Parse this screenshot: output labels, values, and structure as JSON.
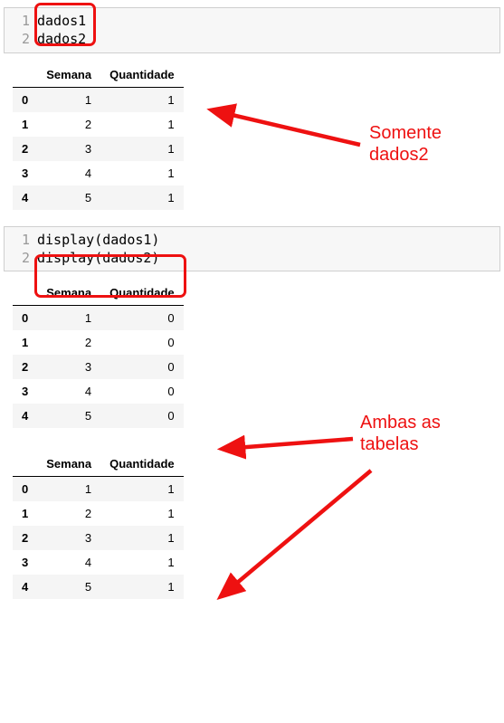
{
  "cell1": {
    "lines": [
      {
        "num": "1",
        "code": "dados1"
      },
      {
        "num": "2",
        "code": "dados2"
      }
    ]
  },
  "cell2": {
    "lines": [
      {
        "num": "1",
        "code": "display(dados1)"
      },
      {
        "num": "2",
        "code": "display(dados2)"
      }
    ]
  },
  "columns": {
    "c1": "Semana",
    "c2": "Quantidade"
  },
  "table_top": {
    "rows": [
      {
        "idx": "0",
        "semana": "1",
        "qty": "1"
      },
      {
        "idx": "1",
        "semana": "2",
        "qty": "1"
      },
      {
        "idx": "2",
        "semana": "3",
        "qty": "1"
      },
      {
        "idx": "3",
        "semana": "4",
        "qty": "1"
      },
      {
        "idx": "4",
        "semana": "5",
        "qty": "1"
      }
    ]
  },
  "table_mid": {
    "rows": [
      {
        "idx": "0",
        "semana": "1",
        "qty": "0"
      },
      {
        "idx": "1",
        "semana": "2",
        "qty": "0"
      },
      {
        "idx": "2",
        "semana": "3",
        "qty": "0"
      },
      {
        "idx": "3",
        "semana": "4",
        "qty": "0"
      },
      {
        "idx": "4",
        "semana": "5",
        "qty": "0"
      }
    ]
  },
  "table_bot": {
    "rows": [
      {
        "idx": "0",
        "semana": "1",
        "qty": "1"
      },
      {
        "idx": "1",
        "semana": "2",
        "qty": "1"
      },
      {
        "idx": "2",
        "semana": "3",
        "qty": "1"
      },
      {
        "idx": "3",
        "semana": "4",
        "qty": "1"
      },
      {
        "idx": "4",
        "semana": "5",
        "qty": "1"
      }
    ]
  },
  "annotations": {
    "only_dados2": "Somente\ndados2",
    "both_tables": "Ambas as\ntabelas"
  },
  "colors": {
    "highlight": "#e11"
  }
}
